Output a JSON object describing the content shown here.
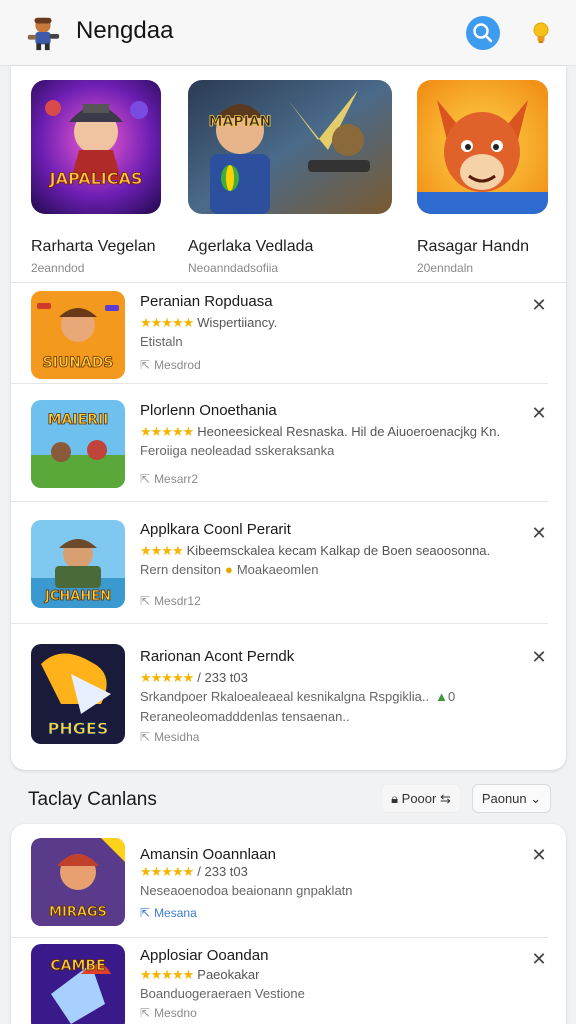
{
  "header": {
    "title": "Nengdaa",
    "logo_icon": "game-character-logo",
    "search_icon": "search-icon",
    "notify_icon": "lightbulb-icon",
    "accent": "#3d9cf0"
  },
  "featured": [
    {
      "title": "Rarharta Vegelan",
      "subtitle": "2eanndod",
      "art_text": "JAPALICAS"
    },
    {
      "title": "Agerlaka Vedlada",
      "subtitle": "Neoanndadsofiia",
      "art_text": "MAPIAN"
    },
    {
      "title": "Rasagar Handn",
      "subtitle": "20enndaln",
      "art_text": ""
    }
  ],
  "list": [
    {
      "title": "Peranian Ropduasa",
      "rating_text": "Wispertiiancy.",
      "desc": "Etistaln",
      "meta": "Mesdrod",
      "art_text": "SIUNADS"
    },
    {
      "title": "Plorlenn Onoethania",
      "rating_text": "Heoneesickeal Resnaska. Hil de Aiuoeroenacjkg Kn.",
      "desc": "Feroiiga neoleadad sskeraksanka",
      "meta": "Mesarr2",
      "art_text": "MAIERII"
    },
    {
      "title": "Applkara Coonl Perarit",
      "rating_text": "Kibeemsckalea kecam Kalkap de Boen seaoosonna.",
      "desc": "Rern densiton",
      "desc_extra": "Moakaeomlen",
      "meta": "Mesdr12",
      "art_text": "JCHAHEN"
    },
    {
      "title": "Rarionan Acont Perndk",
      "rating_text": "/ 233 t03",
      "desc": "Srkandpoer Rkaloealeaeal kesnikalgna Rspgiklia..",
      "desc_extra": "0",
      "desc2": "Reraneoleomadddenlas tensaenan..",
      "meta": "Mesidha",
      "art_text": "PHGES"
    }
  ],
  "today": {
    "section_title": "Taclay Canlans",
    "filter_power": "Pooor",
    "filter_phone": "Paonun",
    "items": [
      {
        "title": "Amansin Ooannlaan",
        "rating_text": "/ 233 t03",
        "desc": "Neseaoenodoa beaionann gnpaklatn",
        "meta": "Mesana",
        "art_text": "MIRAGS"
      },
      {
        "title": "Applosiar Ooandan",
        "rating_text": "Paeokakar",
        "desc": "Boanduogeraeraen Vestione",
        "meta": "Mesdno",
        "art_text": "CAMBE"
      }
    ]
  },
  "colors": {
    "star": "#f4b400",
    "divider": "#e3e4e6",
    "meta_blue": "#3a7bd5"
  }
}
